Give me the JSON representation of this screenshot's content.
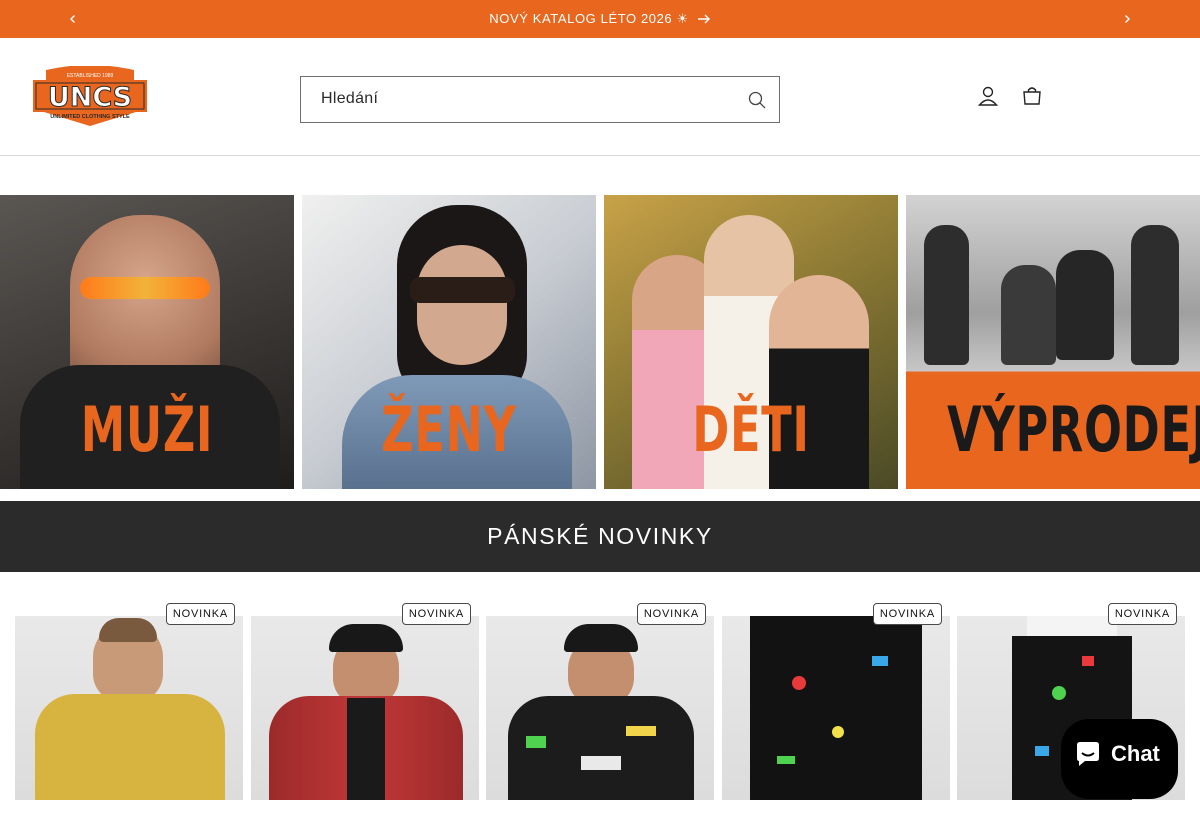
{
  "announcement": {
    "text": "NOVÝ KATALOG LÉTO 2026 ☀"
  },
  "header": {
    "logo": {
      "established": "ESTABLISHED 1989",
      "brand": "UNCS",
      "tagline": "UNLIMITED CLOTHING STYLE"
    },
    "search": {
      "placeholder": "Hledání"
    }
  },
  "categories": [
    {
      "label": "MUŽI"
    },
    {
      "label": "ŽENY"
    },
    {
      "label": "DĚTI"
    },
    {
      "label": "VÝPRODEJ"
    }
  ],
  "section": {
    "title": "PÁNSKÉ NOVINKY"
  },
  "products": [
    {
      "badge": "NOVINKA",
      "icon": "yellow-tshirt"
    },
    {
      "badge": "NOVINKA",
      "icon": "red-jacket"
    },
    {
      "badge": "NOVINKA",
      "icon": "black-graphic-hoodie"
    },
    {
      "badge": "NOVINKA",
      "icon": "black-paint-sweatpants"
    },
    {
      "badge": "NOVINKA",
      "icon": "black-paint-sweatpants-side"
    }
  ],
  "chat": {
    "label": "Chat"
  },
  "colors": {
    "accent": "#e8661e",
    "band": "#2b2b2b",
    "chat": "#000000"
  }
}
